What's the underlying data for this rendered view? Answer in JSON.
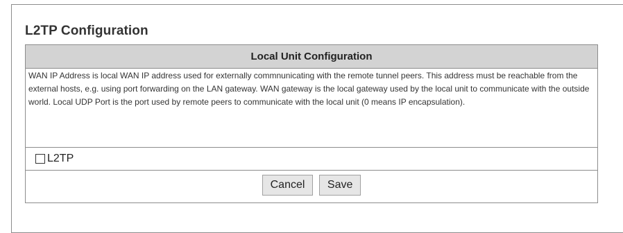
{
  "page": {
    "title": "L2TP Configuration"
  },
  "section": {
    "header": "Local Unit Configuration",
    "description": "WAN IP Address is local WAN IP address used for externally commnunicating with the remote tunnel peers. This address must be reachable from the external hosts, e.g. using port forwarding on the LAN gateway. WAN gateway is the local gateway used by the local unit to communicate with the outside world. Local UDP Port is the port used by remote peers to communicate with the local unit (0 means IP encapsulation)."
  },
  "l2tp_toggle": {
    "label": "L2TP",
    "checked": false
  },
  "actions": {
    "cancel_label": "Cancel",
    "save_label": "Save"
  },
  "colors": {
    "header_background": "#d3d3d3",
    "border": "#8c8c8c",
    "button_background": "#e6e6e6"
  }
}
